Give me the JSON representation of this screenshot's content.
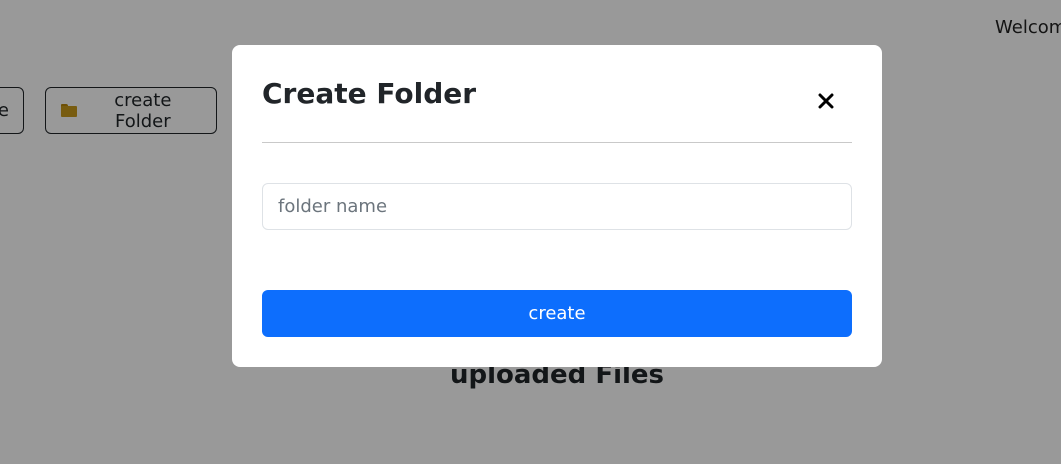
{
  "header": {
    "welcome_text": "Welcom"
  },
  "toolbar": {
    "left_button_label": "e",
    "create_folder_label": "create Folder"
  },
  "main": {
    "section_title": "uploaded Files"
  },
  "modal": {
    "title": "Create Folder",
    "folder_name_placeholder": "folder name",
    "folder_name_value": "",
    "create_label": "create"
  },
  "colors": {
    "primary": "#0d6efd",
    "folder_icon": "#c99a1c",
    "overlay": "rgba(0,0,0,0.40)"
  },
  "icons": {
    "close": "close-icon",
    "folder": "folder-icon"
  }
}
